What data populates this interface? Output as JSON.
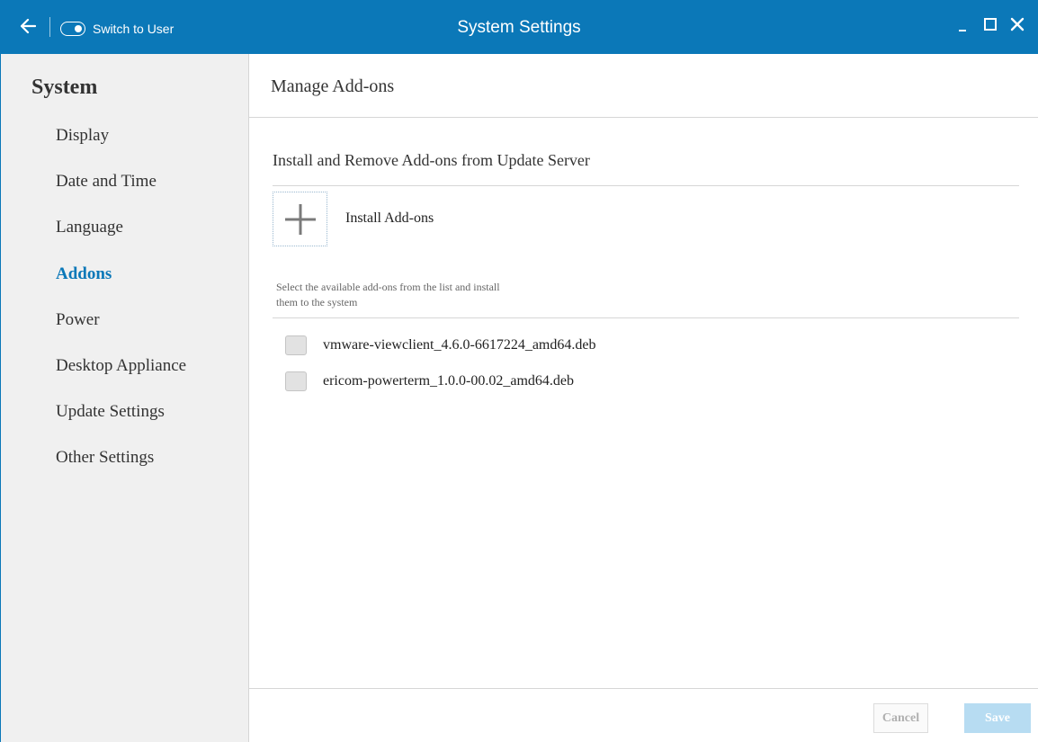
{
  "titlebar": {
    "switch_label": "Switch to User",
    "title": "System Settings",
    "back_icon": "arrow-left-icon",
    "minimize_icon": "minimize-icon",
    "maximize_icon": "maximize-icon",
    "close_icon": "close-icon",
    "color": "#0b78b8"
  },
  "sidebar": {
    "heading": "System",
    "items": [
      {
        "label": "Display",
        "active": false
      },
      {
        "label": "Date and Time",
        "active": false
      },
      {
        "label": "Language",
        "active": false
      },
      {
        "label": "Addons",
        "active": true
      },
      {
        "label": "Power",
        "active": false
      },
      {
        "label": "Desktop Appliance",
        "active": false
      },
      {
        "label": "Update Settings",
        "active": false
      },
      {
        "label": "Other Settings",
        "active": false
      }
    ],
    "active_color": "#0b78b8"
  },
  "main": {
    "page_title": "Manage Add-ons",
    "section_title": "Install and Remove Add-ons from Update Server",
    "install_label": "Install Add-ons",
    "install_icon": "plus-icon",
    "hint": "Select the available add-ons from the list and install them to the system",
    "addons": [
      {
        "name": "vmware-viewclient_4.6.0-6617224_amd64.deb",
        "checked": false
      },
      {
        "name": "ericom-powerterm_1.0.0-00.02_amd64.deb",
        "checked": false
      }
    ]
  },
  "footer": {
    "cancel_label": "Cancel",
    "save_label": "Save"
  }
}
